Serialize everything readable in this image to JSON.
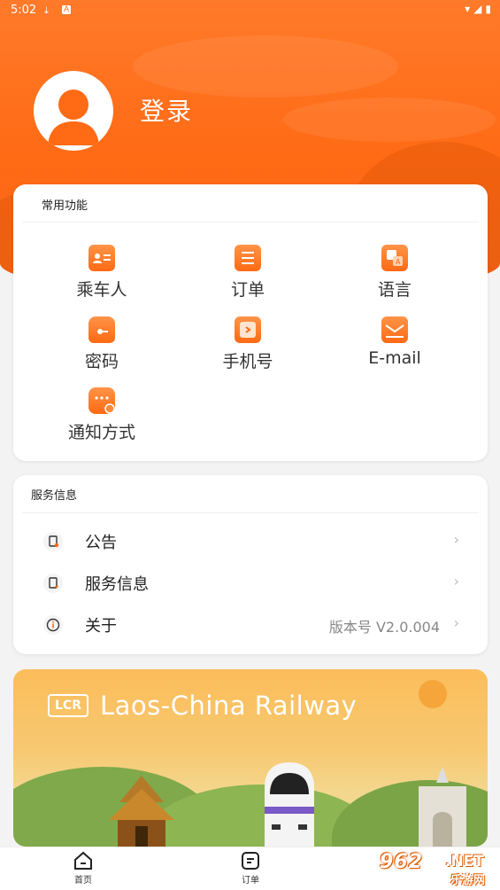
{
  "status_bar": {
    "time": "5:02",
    "icons": [
      "download-icon",
      "a-icon",
      "wifi-icon",
      "signal-icon",
      "battery-icon"
    ]
  },
  "profile": {
    "login_label": "登录",
    "avatar_icon": "user-avatar-icon"
  },
  "common_functions": {
    "title": "常用功能",
    "items": [
      {
        "label": "乘车人",
        "icon": "passenger-card-icon"
      },
      {
        "label": "订单",
        "icon": "order-list-icon"
      },
      {
        "label": "语言",
        "icon": "language-translate-icon"
      },
      {
        "label": "密码",
        "icon": "lock-icon"
      },
      {
        "label": "手机号",
        "icon": "phone-icon"
      },
      {
        "label": "E-mail",
        "icon": "mail-icon"
      },
      {
        "label": "通知方式",
        "icon": "notification-chat-icon"
      }
    ]
  },
  "service_info": {
    "title": "服务信息",
    "rows": [
      {
        "label": "公告",
        "value": "",
        "icon": "announcement-doc-icon"
      },
      {
        "label": "服务信息",
        "value": "",
        "icon": "service-doc-icon"
      },
      {
        "label": "关于",
        "value": "版本号 V2.0.004",
        "icon": "info-icon"
      }
    ]
  },
  "banner": {
    "logo_text": "LCR",
    "brand_text": "Laos-China Railway"
  },
  "tabbar": {
    "tabs": [
      {
        "label": "首页",
        "icon": "home-icon"
      },
      {
        "label": "订单",
        "icon": "order-tab-icon"
      }
    ]
  },
  "watermark": {
    "number": "962",
    "domain": ".NET",
    "cn_text": "乐游网"
  },
  "colors": {
    "accent": "#ff6a14",
    "background": "#f3f3f3",
    "card": "#ffffff"
  }
}
